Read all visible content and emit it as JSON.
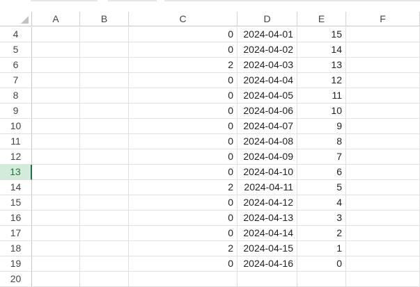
{
  "sheet": {
    "columns": [
      "A",
      "B",
      "C",
      "D",
      "E",
      "F"
    ],
    "rows": [
      {
        "row": "4",
        "c": "0",
        "d": "2024-04-01",
        "e": "15"
      },
      {
        "row": "5",
        "c": "0",
        "d": "2024-04-02",
        "e": "14"
      },
      {
        "row": "6",
        "c": "2",
        "d": "2024-04-03",
        "e": "13"
      },
      {
        "row": "7",
        "c": "0",
        "d": "2024-04-04",
        "e": "12"
      },
      {
        "row": "8",
        "c": "0",
        "d": "2024-04-05",
        "e": "11"
      },
      {
        "row": "9",
        "c": "0",
        "d": "2024-04-06",
        "e": "10"
      },
      {
        "row": "10",
        "c": "0",
        "d": "2024-04-07",
        "e": "9"
      },
      {
        "row": "11",
        "c": "0",
        "d": "2024-04-08",
        "e": "8"
      },
      {
        "row": "12",
        "c": "0",
        "d": "2024-04-09",
        "e": "7"
      },
      {
        "row": "13",
        "c": "0",
        "d": "2024-04-10",
        "e": "6"
      },
      {
        "row": "14",
        "c": "2",
        "d": "2024-04-11",
        "e": "5"
      },
      {
        "row": "15",
        "c": "0",
        "d": "2024-04-12",
        "e": "4"
      },
      {
        "row": "16",
        "c": "0",
        "d": "2024-04-13",
        "e": "3"
      },
      {
        "row": "17",
        "c": "0",
        "d": "2024-04-14",
        "e": "2"
      },
      {
        "row": "18",
        "c": "2",
        "d": "2024-04-15",
        "e": "1"
      },
      {
        "row": "19",
        "c": "0",
        "d": "2024-04-16",
        "e": "0"
      },
      {
        "row": "20",
        "c": "",
        "d": "",
        "e": ""
      }
    ],
    "active_row": "13",
    "colors": {
      "active_row_header_bg": "#d2ecd9",
      "active_row_header_text": "#217346",
      "grid_line": "#e1e1e1"
    }
  }
}
